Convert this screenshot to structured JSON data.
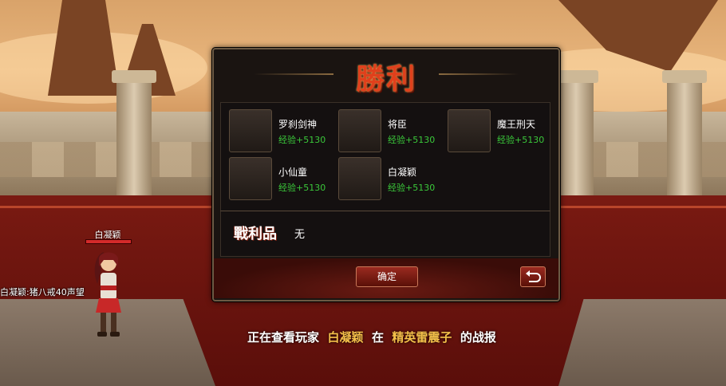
{
  "dialog": {
    "title": "勝利",
    "members": [
      {
        "name": "罗刹剑神",
        "exp": "经验+5130"
      },
      {
        "name": "将臣",
        "exp": "经验+5130"
      },
      {
        "name": "魔王刑天",
        "exp": "经验+5130"
      },
      {
        "name": "小仙童",
        "exp": "经验+5130"
      },
      {
        "name": "白凝颖",
        "exp": "经验+5130"
      }
    ],
    "loot_label": "戰利品",
    "loot_value": "无",
    "confirm_label": "确定",
    "back_icon": "return-arrow-icon"
  },
  "player": {
    "name": "白凝颖",
    "guild_text": "白凝颖:猪八戒40声望",
    "hp_color": "#d42a2a"
  },
  "status": {
    "prefix": "正在查看玩家",
    "player": "白凝颖",
    "middle": "在",
    "boss": "精英雷震子",
    "suffix": "的战报"
  },
  "colors": {
    "title": "#e0401c",
    "exp": "#3ac83a",
    "highlight": "#f4c04a"
  }
}
